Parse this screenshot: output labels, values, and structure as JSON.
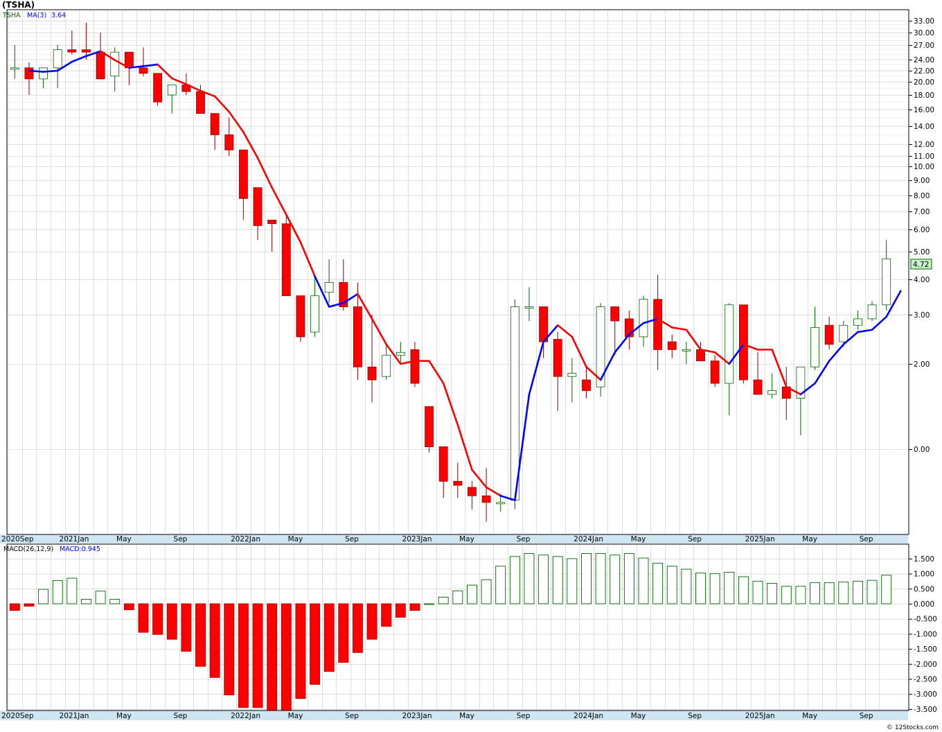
{
  "title": "(TSHA)",
  "legend": {
    "symbol": "TSHA",
    "ma_label": "MA(3)",
    "ma_value": "3.64"
  },
  "macd_legend": {
    "label": "MACD(26,12,9)",
    "value_text": "MACD:0.945"
  },
  "last_price_text": "4.72",
  "footer": "© 12Stocks.com",
  "colors": {
    "down": "#ff0000",
    "up": "#ffffff",
    "up_border": "#006400",
    "ma_up": "#0000ff",
    "ma_down": "#ff0000",
    "macd_pos": "#006400",
    "macd_neg": "#ff0000",
    "axis_band": "#cfe6f2",
    "grid": "#c8c8c8",
    "price_box": "#c8f0c8"
  },
  "x_axis_labels": [
    "2020Sep",
    "2021Jan",
    "May",
    "Sep",
    "2022Jan",
    "May",
    "Sep",
    "2023Jan",
    "May",
    "Sep",
    "2024Jan",
    "May",
    "Sep",
    "2025Jan",
    "May",
    "Sep"
  ],
  "chart_data": [
    {
      "type": "candlestick",
      "scale": "log",
      "y_tick_labels": [
        "33.00",
        "30.00",
        "27.00",
        "24.00",
        "22.00",
        "20.00",
        "18.00",
        "16.00",
        "14.00",
        "12.00",
        "11.00",
        "10.00",
        "9.00",
        "8.00",
        "7.00",
        "6.00",
        "5.00",
        "4.00",
        "3.00",
        "2.00",
        "0.00"
      ],
      "grid": true,
      "candles": [
        {
          "o": 22.5,
          "h": 27.0,
          "l": 20.5,
          "c": 22.5
        },
        {
          "o": 22.5,
          "h": 23.5,
          "l": 18.0,
          "c": 20.5
        },
        {
          "o": 20.5,
          "h": 22.5,
          "l": 19.0,
          "c": 22.5
        },
        {
          "o": 22.5,
          "h": 27.0,
          "l": 19.0,
          "c": 26.0
        },
        {
          "o": 26.0,
          "h": 30.5,
          "l": 25.0,
          "c": 25.5
        },
        {
          "o": 26.0,
          "h": 32.5,
          "l": 24.0,
          "c": 25.5
        },
        {
          "o": 25.5,
          "h": 30.0,
          "l": 20.5,
          "c": 20.5
        },
        {
          "o": 21.0,
          "h": 26.5,
          "l": 18.5,
          "c": 25.5
        },
        {
          "o": 25.5,
          "h": 25.5,
          "l": 19.5,
          "c": 22.5
        },
        {
          "o": 22.5,
          "h": 26.5,
          "l": 21.0,
          "c": 21.5
        },
        {
          "o": 21.5,
          "h": 21.5,
          "l": 16.5,
          "c": 17.0
        },
        {
          "o": 18.0,
          "h": 19.5,
          "l": 15.5,
          "c": 19.5
        },
        {
          "o": 19.5,
          "h": 21.5,
          "l": 18.0,
          "c": 18.5
        },
        {
          "o": 18.5,
          "h": 19.5,
          "l": 15.5,
          "c": 15.5
        },
        {
          "o": 15.5,
          "h": 15.5,
          "l": 11.5,
          "c": 13.0
        },
        {
          "o": 13.0,
          "h": 15.0,
          "l": 11.0,
          "c": 11.5
        },
        {
          "o": 11.5,
          "h": 11.5,
          "l": 6.5,
          "c": 7.8
        },
        {
          "o": 8.5,
          "h": 8.5,
          "l": 5.5,
          "c": 6.2
        },
        {
          "o": 6.5,
          "h": 6.5,
          "l": 5.0,
          "c": 6.3
        },
        {
          "o": 6.3,
          "h": 6.8,
          "l": 3.5,
          "c": 3.5
        },
        {
          "o": 3.5,
          "h": 3.5,
          "l": 2.4,
          "c": 2.5
        },
        {
          "o": 2.6,
          "h": 4.1,
          "l": 2.5,
          "c": 3.5
        },
        {
          "o": 3.6,
          "h": 4.7,
          "l": 3.3,
          "c": 3.9
        },
        {
          "o": 3.9,
          "h": 4.7,
          "l": 3.1,
          "c": 3.2
        },
        {
          "o": 3.2,
          "h": 3.9,
          "l": 1.75,
          "c": 1.95
        },
        {
          "o": 1.95,
          "h": 3.0,
          "l": 1.45,
          "c": 1.75
        },
        {
          "o": 1.8,
          "h": 2.35,
          "l": 1.75,
          "c": 2.15
        },
        {
          "o": 2.15,
          "h": 2.4,
          "l": 2.0,
          "c": 2.2
        },
        {
          "o": 2.25,
          "h": 2.4,
          "l": 1.65,
          "c": 1.7
        },
        {
          "o": 1.4,
          "h": 1.4,
          "l": 0.96,
          "c": 1.0
        },
        {
          "o": 1.0,
          "h": 1.0,
          "l": 0.72,
          "c": 0.8
        },
        {
          "o": 0.8,
          "h": 0.9,
          "l": 0.72,
          "c": 0.78
        },
        {
          "o": 0.77,
          "h": 0.8,
          "l": 0.67,
          "c": 0.73
        },
        {
          "o": 0.73,
          "h": 0.87,
          "l": 0.62,
          "c": 0.7
        },
        {
          "o": 0.7,
          "h": 0.74,
          "l": 0.66,
          "c": 0.7
        },
        {
          "o": 0.71,
          "h": 3.4,
          "l": 0.67,
          "c": 3.2
        },
        {
          "o": 3.2,
          "h": 3.75,
          "l": 2.85,
          "c": 3.2
        },
        {
          "o": 3.2,
          "h": 3.2,
          "l": 2.1,
          "c": 2.4
        },
        {
          "o": 2.45,
          "h": 2.6,
          "l": 1.35,
          "c": 1.8
        },
        {
          "o": 1.8,
          "h": 2.1,
          "l": 1.45,
          "c": 1.85
        },
        {
          "o": 1.75,
          "h": 1.95,
          "l": 1.5,
          "c": 1.6
        },
        {
          "o": 1.65,
          "h": 3.3,
          "l": 1.52,
          "c": 3.2
        },
        {
          "o": 3.2,
          "h": 3.2,
          "l": 2.15,
          "c": 2.85
        },
        {
          "o": 2.9,
          "h": 3.1,
          "l": 2.25,
          "c": 2.5
        },
        {
          "o": 2.5,
          "h": 3.5,
          "l": 2.3,
          "c": 3.4
        },
        {
          "o": 3.4,
          "h": 4.15,
          "l": 1.9,
          "c": 2.25
        },
        {
          "o": 2.4,
          "h": 2.55,
          "l": 2.1,
          "c": 2.25
        },
        {
          "o": 2.25,
          "h": 2.4,
          "l": 2.0,
          "c": 2.25
        },
        {
          "o": 2.25,
          "h": 2.4,
          "l": 2.05,
          "c": 2.05
        },
        {
          "o": 2.05,
          "h": 2.15,
          "l": 1.65,
          "c": 1.7
        },
        {
          "o": 1.7,
          "h": 3.3,
          "l": 1.3,
          "c": 3.25
        },
        {
          "o": 3.25,
          "h": 3.25,
          "l": 1.7,
          "c": 1.75
        },
        {
          "o": 1.75,
          "h": 2.2,
          "l": 1.55,
          "c": 1.55
        },
        {
          "o": 1.55,
          "h": 1.85,
          "l": 1.5,
          "c": 1.6
        },
        {
          "o": 1.65,
          "h": 1.95,
          "l": 1.25,
          "c": 1.5
        },
        {
          "o": 1.5,
          "h": 1.95,
          "l": 1.1,
          "c": 1.95
        },
        {
          "o": 1.95,
          "h": 3.2,
          "l": 1.9,
          "c": 2.7
        },
        {
          "o": 2.75,
          "h": 2.95,
          "l": 2.25,
          "c": 2.35
        },
        {
          "o": 2.4,
          "h": 2.85,
          "l": 2.3,
          "c": 2.75
        },
        {
          "o": 2.75,
          "h": 3.1,
          "l": 2.65,
          "c": 2.9
        },
        {
          "o": 2.9,
          "h": 3.35,
          "l": 2.85,
          "c": 3.25
        },
        {
          "o": 3.25,
          "h": 5.5,
          "l": 3.1,
          "c": 4.72
        }
      ],
      "ma3": [
        22.0,
        21.8,
        22.0,
        23.6,
        24.7,
        25.7,
        23.9,
        22.5,
        22.8,
        23.1,
        20.6,
        19.6,
        18.6,
        17.8,
        15.7,
        13.3,
        10.8,
        8.5,
        6.8,
        5.4,
        4.1,
        3.2,
        3.3,
        3.55,
        2.9,
        2.35,
        2.0,
        2.05,
        2.05,
        1.7,
        1.2,
        0.86,
        0.77,
        0.73,
        0.71,
        1.55,
        2.4,
        2.75,
        2.5,
        1.95,
        1.75,
        2.2,
        2.55,
        2.8,
        2.9,
        2.7,
        2.65,
        2.25,
        2.2,
        2.0,
        2.35,
        2.25,
        2.25,
        1.65,
        1.55,
        1.7,
        2.05,
        2.35,
        2.6,
        2.65,
        2.95,
        3.64
      ],
      "ma_direction": [
        "u",
        "u",
        "u",
        "u",
        "u",
        "u",
        "d",
        "d",
        "u",
        "u",
        "d",
        "d",
        "d",
        "d",
        "d",
        "d",
        "d",
        "d",
        "d",
        "d",
        "d",
        "u",
        "u",
        "u",
        "d",
        "d",
        "d",
        "d",
        "d",
        "d",
        "d",
        "d",
        "d",
        "d",
        "u",
        "u",
        "u",
        "u",
        "d",
        "d",
        "d",
        "u",
        "u",
        "u",
        "u",
        "d",
        "d",
        "d",
        "d",
        "d",
        "u",
        "d",
        "d",
        "d",
        "d",
        "u",
        "u",
        "u",
        "u",
        "u",
        "u",
        "u"
      ]
    },
    {
      "type": "bar",
      "name": "MACD(26,12,9)",
      "y_tick_labels": [
        "1.500",
        "1.000",
        "0.500",
        "0.000",
        "-0.500",
        "-1.000",
        "-1.500",
        "-2.000",
        "-2.500",
        "-3.000",
        "-3.500"
      ],
      "ylim": [
        -3.6,
        1.8
      ],
      "values": [
        -0.22,
        -0.08,
        0.48,
        0.77,
        0.85,
        0.15,
        0.42,
        0.15,
        -0.2,
        -0.95,
        -1.02,
        -1.18,
        -1.58,
        -2.08,
        -2.45,
        -3.03,
        -3.45,
        -3.45,
        -3.6,
        -3.6,
        -3.15,
        -2.68,
        -2.25,
        -1.95,
        -1.62,
        -1.18,
        -0.75,
        -0.45,
        -0.22,
        0.0,
        0.22,
        0.43,
        0.62,
        0.8,
        1.25,
        1.57,
        1.67,
        1.62,
        1.57,
        1.5,
        1.67,
        1.67,
        1.62,
        1.67,
        1.52,
        1.35,
        1.25,
        1.15,
        1.02,
        1.0,
        1.05,
        0.9,
        0.75,
        0.68,
        0.58,
        0.58,
        0.7,
        0.7,
        0.72,
        0.75,
        0.78,
        0.95
      ]
    }
  ]
}
